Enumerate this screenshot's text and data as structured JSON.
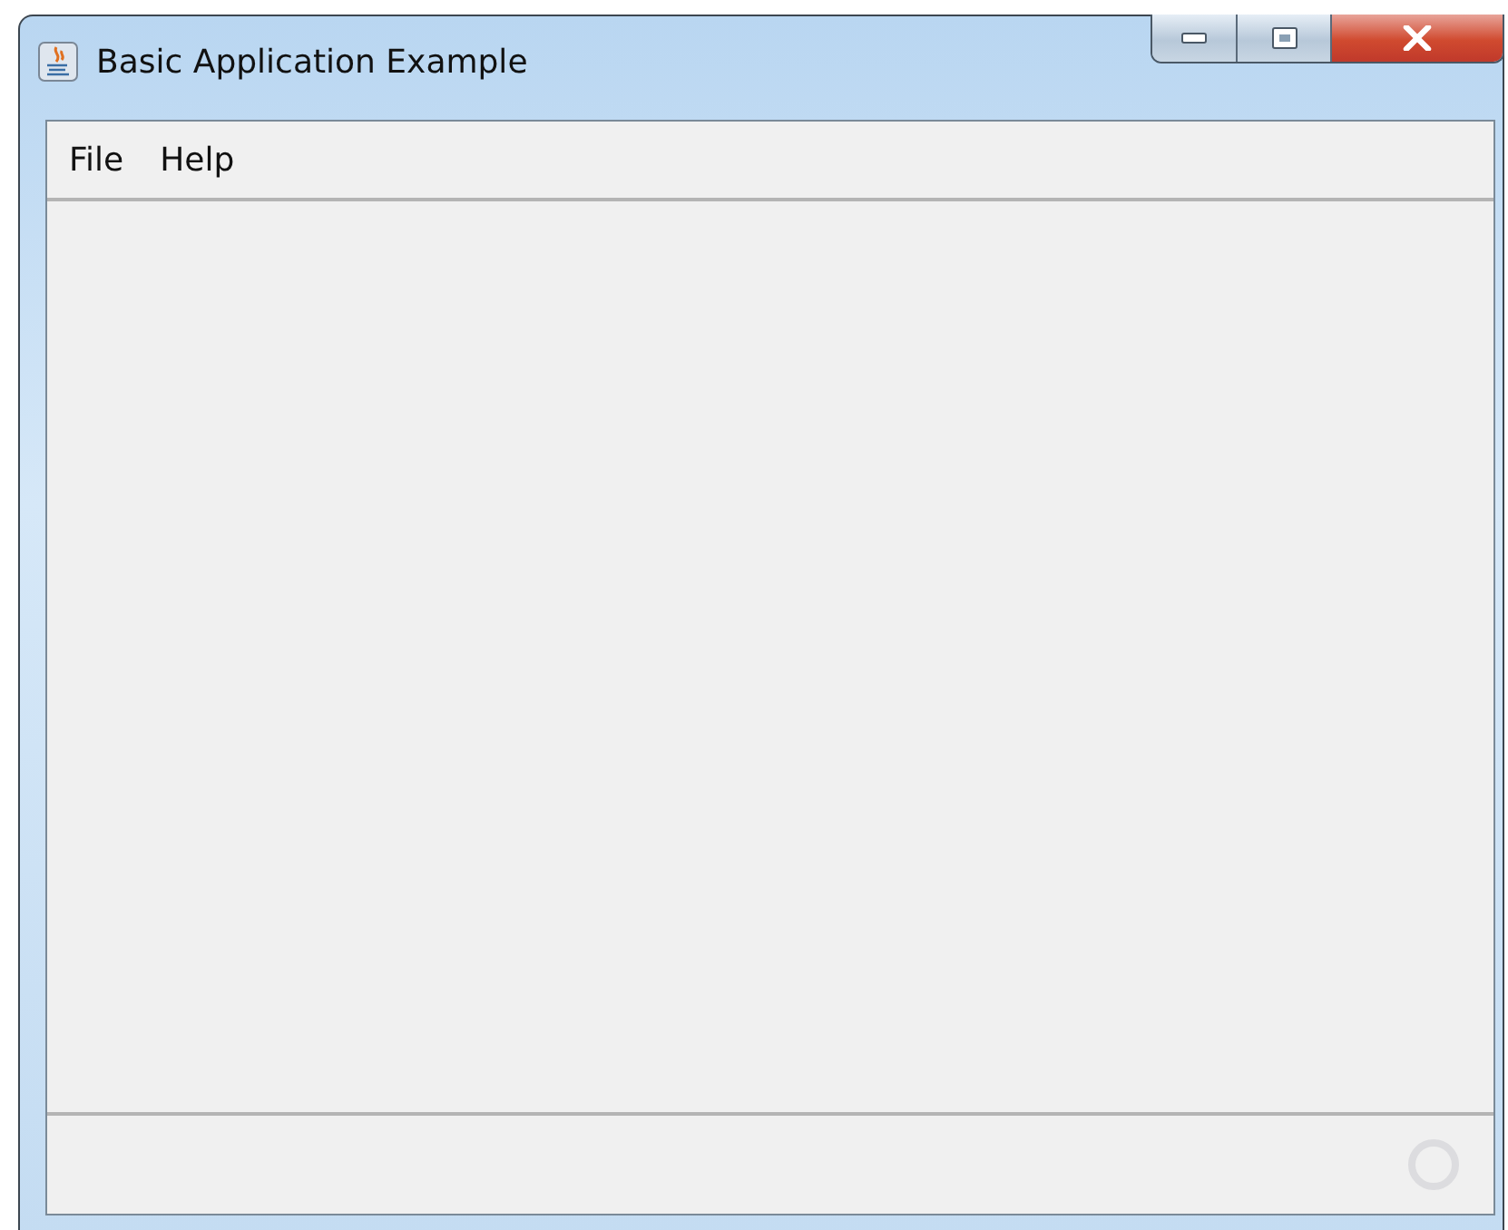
{
  "window": {
    "title": "Basic Application Example"
  },
  "menu": [
    {
      "label": "File"
    },
    {
      "label": "Help"
    }
  ]
}
